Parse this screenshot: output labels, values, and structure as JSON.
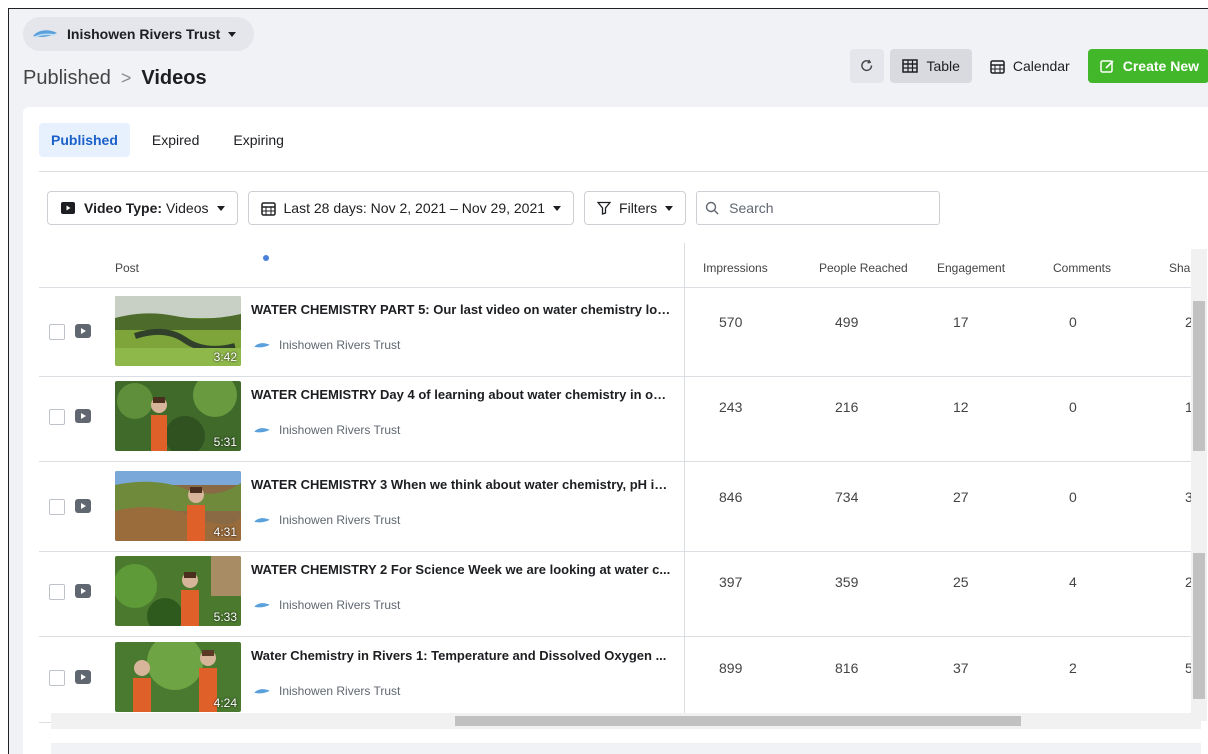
{
  "page_selector": {
    "name": "Inishowen Rivers Trust"
  },
  "breadcrumb": {
    "parent": "Published",
    "current": "Videos",
    "separator": ">"
  },
  "toolbar": {
    "refresh_icon": "refresh-icon",
    "table_label": "Table",
    "calendar_label": "Calendar",
    "create_label": "Create New",
    "accent": "#42b72a"
  },
  "tabs": [
    {
      "label": "Published",
      "active": true
    },
    {
      "label": "Expired",
      "active": false
    },
    {
      "label": "Expiring",
      "active": false
    }
  ],
  "filters": {
    "video_type_prefix": "Video Type:",
    "video_type_value": "Videos",
    "date_range": "Last 28 days: Nov 2, 2021 – Nov 29, 2021",
    "filters_label": "Filters",
    "search_placeholder": "Search"
  },
  "table": {
    "headers": {
      "post": "Post",
      "impressions": "Impressions",
      "reach": "People Reached",
      "engagement": "Engagement",
      "comments": "Comments",
      "shares": "Share"
    },
    "rows": [
      {
        "title": "WATER CHEMISTRY PART 5: Our last video on water chemistry loo...",
        "author": "Inishowen Rivers Trust",
        "duration": "3:42",
        "impressions": "570",
        "reach": "499",
        "engagement": "17",
        "comments": "0",
        "shares": "2"
      },
      {
        "title": "WATER CHEMISTRY Day 4 of learning about water chemistry in ou...",
        "author": "Inishowen Rivers Trust",
        "duration": "5:31",
        "impressions": "243",
        "reach": "216",
        "engagement": "12",
        "comments": "0",
        "shares": "1"
      },
      {
        "title": "WATER CHEMISTRY 3 When we think about water chemistry, pH is...",
        "author": "Inishowen Rivers Trust",
        "duration": "4:31",
        "impressions": "846",
        "reach": "734",
        "engagement": "27",
        "comments": "0",
        "shares": "3"
      },
      {
        "title": "WATER CHEMISTRY 2 For Science Week we are looking at water c...",
        "author": "Inishowen Rivers Trust",
        "duration": "5:33",
        "impressions": "397",
        "reach": "359",
        "engagement": "25",
        "comments": "4",
        "shares": "2"
      },
      {
        "title": "Water Chemistry in Rivers 1: Temperature and Dissolved Oxygen ...",
        "author": "Inishowen Rivers Trust",
        "duration": "4:24",
        "impressions": "899",
        "reach": "816",
        "engagement": "37",
        "comments": "2",
        "shares": "5"
      }
    ]
  }
}
